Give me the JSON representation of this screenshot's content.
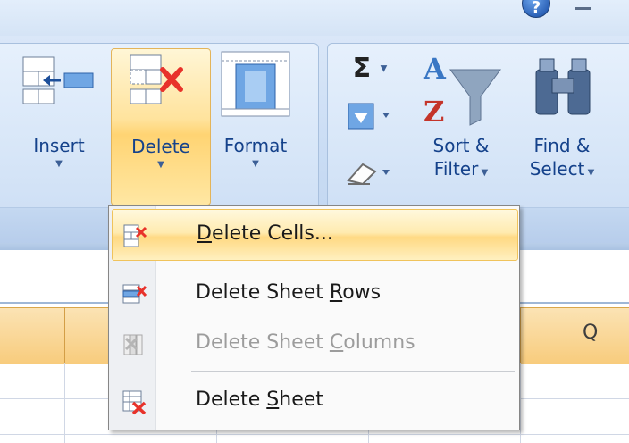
{
  "ribbon": {
    "cells_group": {
      "insert_label": "Insert",
      "delete_label": "Delete",
      "format_label": "Format"
    },
    "editing_group": {
      "sigma_symbol": "Σ",
      "sort_filter_line1": "Sort &",
      "sort_filter_line2": "Filter",
      "find_select_line1": "Find &",
      "find_select_line2": "Select"
    }
  },
  "sheet": {
    "visible_column": "Q"
  },
  "delete_menu": {
    "items": [
      {
        "pre": "",
        "key": "D",
        "post": "elete Cells...",
        "state": "highlighted",
        "icon": "delete-cells-icon"
      },
      {
        "pre": "Delete Sheet ",
        "key": "R",
        "post": "ows",
        "state": "enabled",
        "icon": "delete-rows-icon"
      },
      {
        "pre": "Delete Sheet ",
        "key": "C",
        "post": "olumns",
        "state": "disabled",
        "icon": "delete-columns-icon"
      },
      {
        "pre": "Delete ",
        "key": "S",
        "post": "heet",
        "state": "enabled",
        "icon": "delete-sheet-icon"
      }
    ]
  },
  "colors": {
    "ribbon_text": "#15428b",
    "menu_highlight": "#ffd983",
    "delete_red": "#e8322a"
  }
}
